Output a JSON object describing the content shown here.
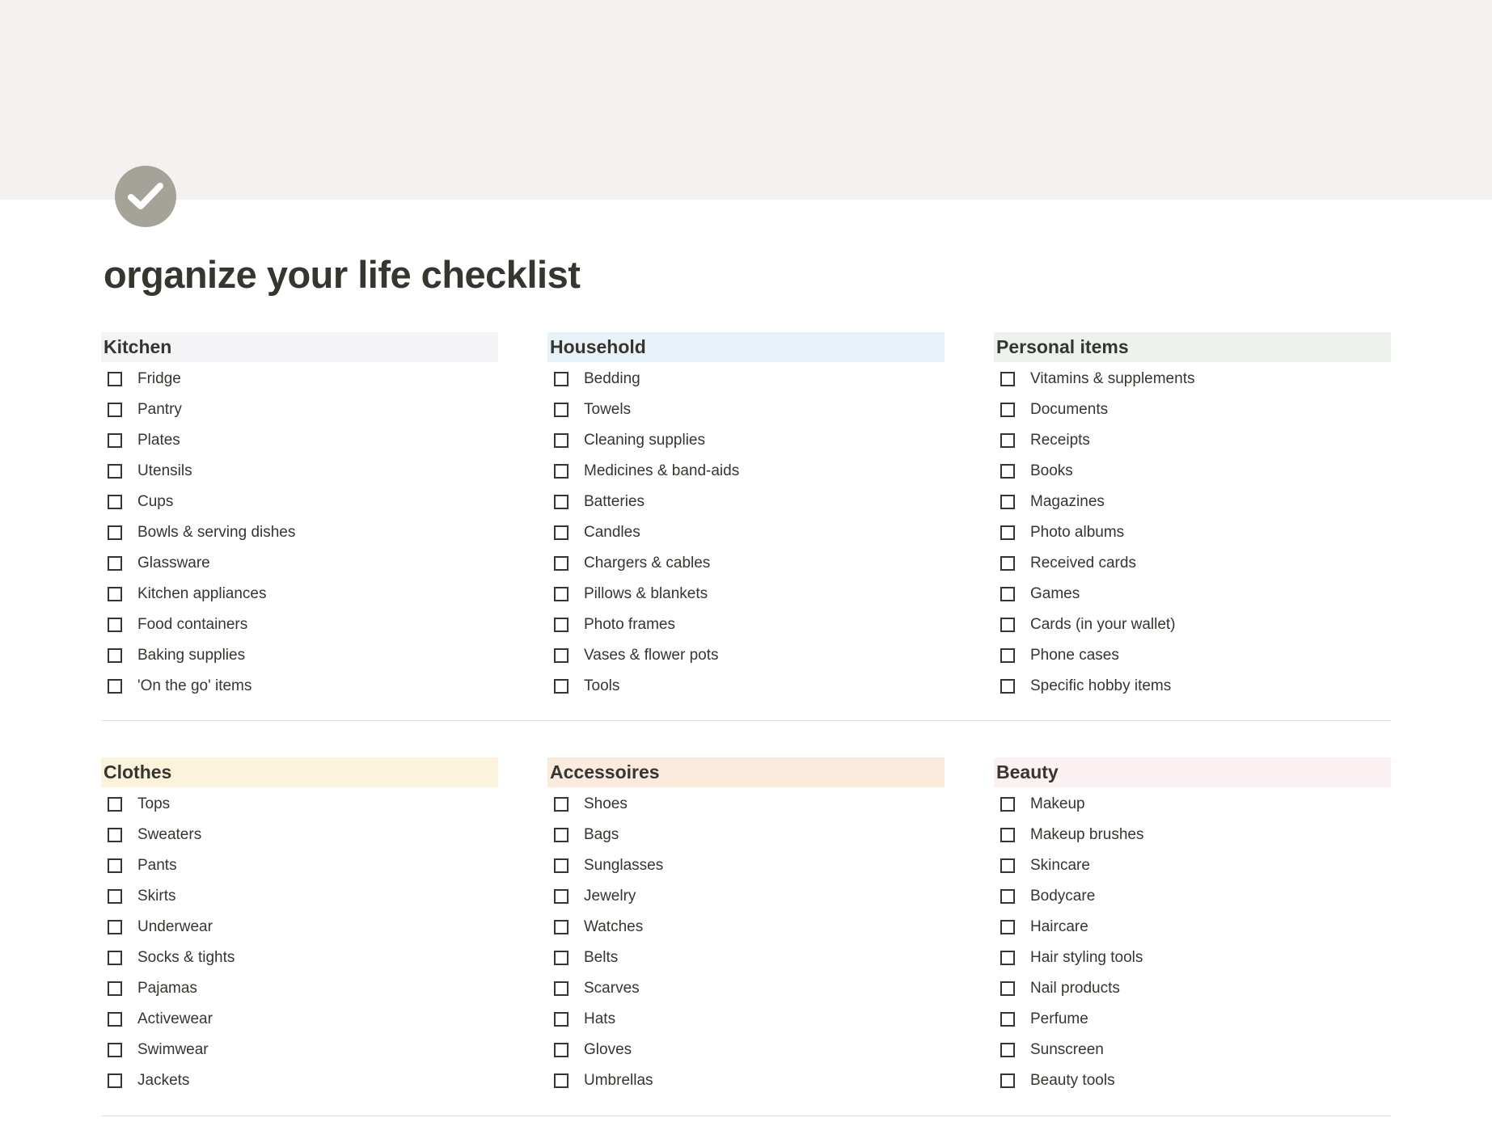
{
  "page": {
    "title": "organize your life checklist",
    "icon": "check-circle-icon"
  },
  "colors": {
    "cover": "#f3f2f0",
    "icon_bg": "#a5a29a",
    "text": "#37352f",
    "kitchen_header": "#f4f3f6",
    "household_header": "#e7f3f8",
    "personal_header": "#edf3ec",
    "clothes_header": "#fbf3db",
    "accessoires_header": "#faebdd",
    "beauty_header": "#fbf0f2"
  },
  "sections": [
    {
      "title": "Kitchen",
      "items": [
        "Fridge",
        "Pantry",
        "Plates",
        "Utensils",
        "Cups",
        "Bowls & serving dishes",
        "Glassware",
        "Kitchen appliances",
        "Food containers",
        "Baking supplies",
        "'On the go' items"
      ]
    },
    {
      "title": "Household",
      "items": [
        "Bedding",
        "Towels",
        "Cleaning supplies",
        "Medicines & band-aids",
        "Batteries",
        "Candles",
        "Chargers & cables",
        "Pillows & blankets",
        "Photo frames",
        "Vases & flower pots",
        "Tools"
      ]
    },
    {
      "title": "Personal items",
      "items": [
        "Vitamins & supplements",
        "Documents",
        "Receipts",
        "Books",
        "Magazines",
        "Photo albums",
        "Received cards",
        "Games",
        "Cards (in your wallet)",
        "Phone cases",
        "Specific hobby items"
      ]
    },
    {
      "title": "Clothes",
      "items": [
        "Tops",
        "Sweaters",
        "Pants",
        "Skirts",
        "Underwear",
        "Socks & tights",
        "Pajamas",
        "Activewear",
        "Swimwear",
        "Jackets"
      ]
    },
    {
      "title": "Accessoires",
      "items": [
        "Shoes",
        "Bags",
        "Sunglasses",
        "Jewelry",
        "Watches",
        "Belts",
        "Scarves",
        "Hats",
        "Gloves",
        "Umbrellas"
      ]
    },
    {
      "title": "Beauty",
      "items": [
        "Makeup",
        "Makeup brushes",
        "Skincare",
        "Bodycare",
        "Haircare",
        "Hair styling tools",
        "Nail products",
        "Perfume",
        "Sunscreen",
        "Beauty tools"
      ]
    }
  ]
}
